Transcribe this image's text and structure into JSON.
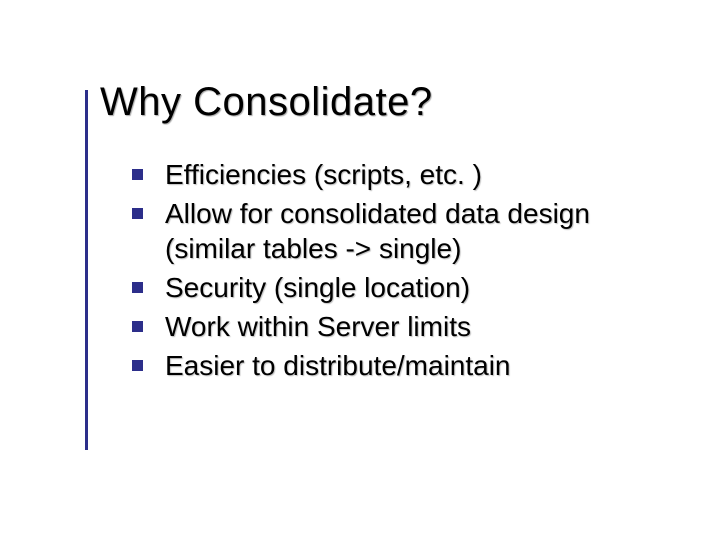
{
  "accent_color": "#2c2e8a",
  "title": "Why Consolidate?",
  "bullets": [
    "Efficiencies (scripts, etc. )",
    "Allow for consolidated data design (similar tables -> single)",
    "Security (single location)",
    "Work within Server limits",
    "Easier to distribute/maintain"
  ]
}
